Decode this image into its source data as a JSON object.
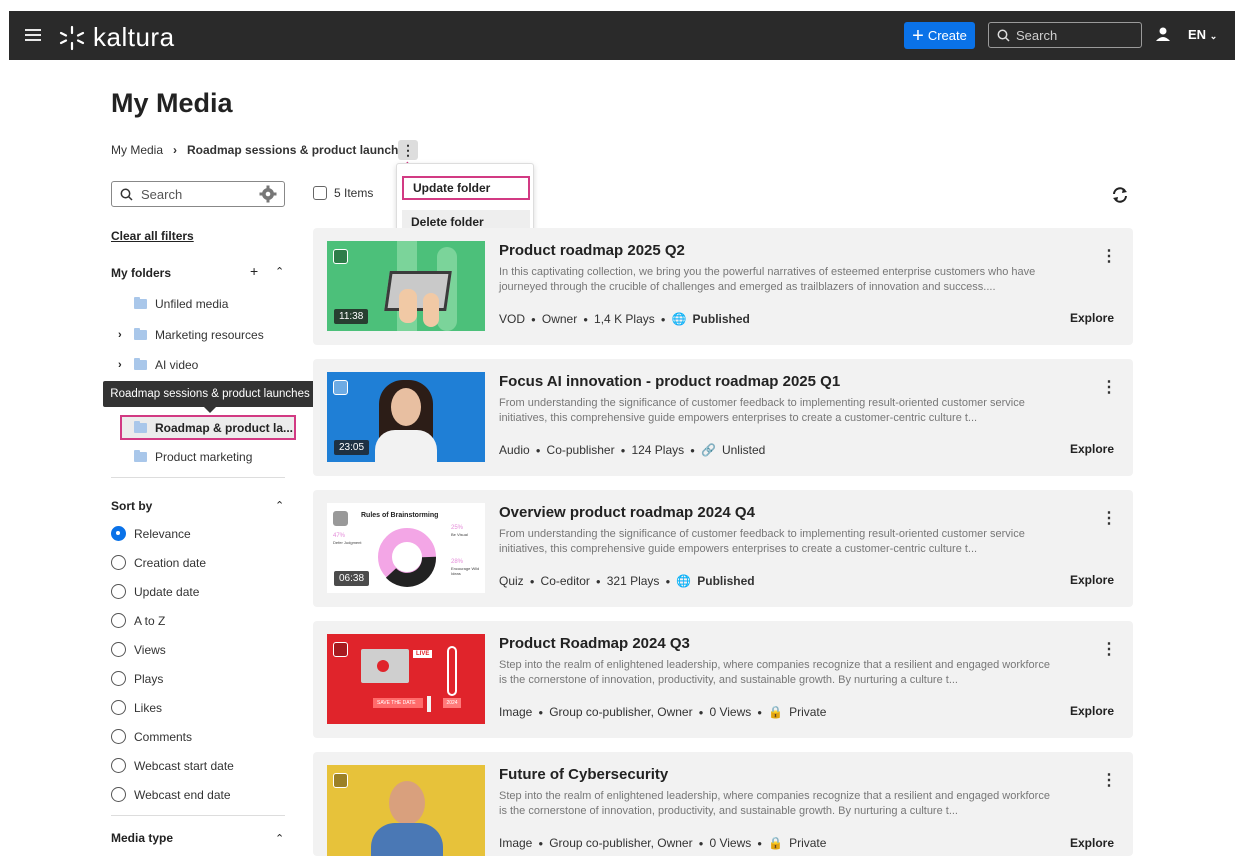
{
  "header": {
    "logo": "kaltura",
    "create_label": "Create",
    "search_placeholder": "Search",
    "language": "EN"
  },
  "page": {
    "title": "My Media",
    "breadcrumb": [
      "My Media",
      "Roadmap sessions & product launches"
    ]
  },
  "folder_menu": {
    "items": [
      "Update folder",
      "Delete folder"
    ]
  },
  "sidebar": {
    "search_placeholder": "Search",
    "clear_filters": "Clear all filters",
    "my_folders_title": "My folders",
    "folders": [
      "Unfiled media",
      "Marketing resources",
      "AI video",
      "Roadmap & product la...",
      "Product marketing"
    ],
    "tooltip": "Roadmap sessions & product launches",
    "sort_title": "Sort by",
    "sort_options": [
      "Relevance",
      "Creation date",
      "Update date",
      "A to Z",
      "Views",
      "Plays",
      "Likes",
      "Comments",
      "Webcast start date",
      "Webcast end date"
    ],
    "sort_selected": "Relevance",
    "media_type_title": "Media type"
  },
  "content": {
    "items_count": "5 Items",
    "explore_label": "Explore",
    "cards": [
      {
        "title": "Product roadmap 2025 Q2",
        "desc": "In this captivating collection, we bring you the powerful narratives of esteemed enterprise customers who have journeyed through the crucible of challenges and emerged as trailblazers of innovation and success....",
        "duration": "11:38",
        "type": "VOD",
        "role": "Owner",
        "stat": "1,4 K Plays",
        "status": "Published"
      },
      {
        "title": "Focus AI innovation - product roadmap 2025 Q1",
        "desc": "From understanding the significance of customer feedback to implementing result-oriented customer service initiatives, this comprehensive guide empowers enterprises to create a customer-centric culture t...",
        "duration": "23:05",
        "type": "Audio",
        "role": "Co-publisher",
        "stat": "124 Plays",
        "status": "Unlisted"
      },
      {
        "title": "Overview product roadmap 2024 Q4",
        "desc": "From understanding the significance of customer feedback to implementing result-oriented customer service initiatives, this comprehensive guide empowers enterprises to create a customer-centric culture t...",
        "duration": "06:38",
        "type": "Quiz",
        "role": "Co-editor",
        "stat": "321 Plays",
        "status": "Published",
        "thumb_title": "Rules of Brainstorming",
        "thumb_stats": [
          "47%",
          "Defer Judgment",
          "25%",
          "Be Visual",
          "28%",
          "Encourage Wild Ideas"
        ]
      },
      {
        "title": "Product Roadmap 2024 Q3",
        "desc": "Step into the realm of enlightened leadership, where companies recognize that a resilient and engaged workforce is the cornerstone of innovation, productivity, and sustainable growth. By nurturing a culture t...",
        "type": "Image",
        "role": "Group co-publisher, Owner",
        "stat": "0 Views",
        "status": "Private",
        "thumb_live": "LIVE",
        "thumb_banner": "SAVE THE DATE",
        "thumb_date": "2024"
      },
      {
        "title": "Future of Cybersecurity",
        "desc": "Step into the realm of enlightened leadership, where companies recognize that a resilient and engaged workforce is the cornerstone of innovation, productivity, and sustainable growth. By nurturing a culture t...",
        "type": "Image",
        "role": "Group co-publisher, Owner",
        "stat": "0 Views",
        "status": "Private"
      }
    ]
  },
  "colors": {
    "topbar": "#2a2a2a",
    "accent": "#0a72e8",
    "highlight": "#d23a83"
  }
}
